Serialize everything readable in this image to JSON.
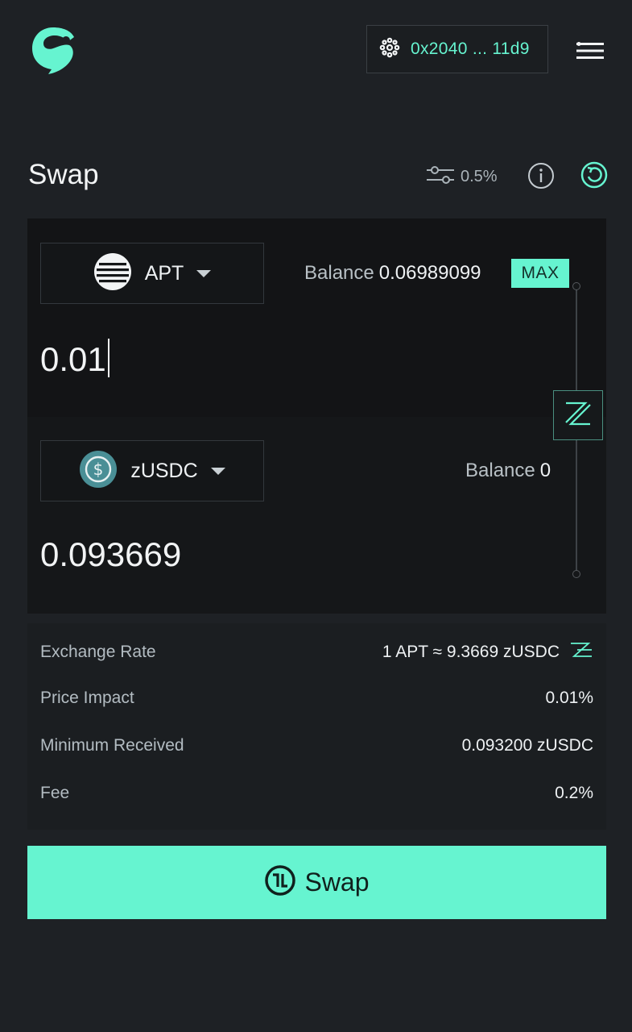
{
  "header": {
    "wallet_address": "0x2040 ... 11d9"
  },
  "swap": {
    "title": "Swap",
    "slippage": "0.5%",
    "from": {
      "token": "APT",
      "balance_label": "Balance",
      "balance": "0.06989099",
      "max_label": "MAX",
      "amount": "0.01"
    },
    "to": {
      "token": "zUSDC",
      "balance_label": "Balance",
      "balance": "0",
      "amount": "0.093669"
    }
  },
  "details": {
    "exchange_rate_label": "Exchange Rate",
    "exchange_rate_value": "1 APT ≈ 9.3669 zUSDC",
    "price_impact_label": "Price Impact",
    "price_impact_value": "0.01%",
    "min_received_label": "Minimum Received",
    "min_received_value": "0.093200 zUSDC",
    "fee_label": "Fee",
    "fee_value": "0.2%"
  },
  "action": {
    "swap_label": "Swap"
  },
  "colors": {
    "accent": "#66f4d0",
    "background": "#1e2125",
    "card": "#151719"
  },
  "icons": [
    "app-logo-icon",
    "wallet-network-icon",
    "menu-icon",
    "slippage-settings-icon",
    "info-icon",
    "refresh-icon",
    "apt-token-icon",
    "usdc-token-icon",
    "chevron-down-icon",
    "swap-direction-icon",
    "rate-toggle-icon",
    "swap-action-icon"
  ]
}
